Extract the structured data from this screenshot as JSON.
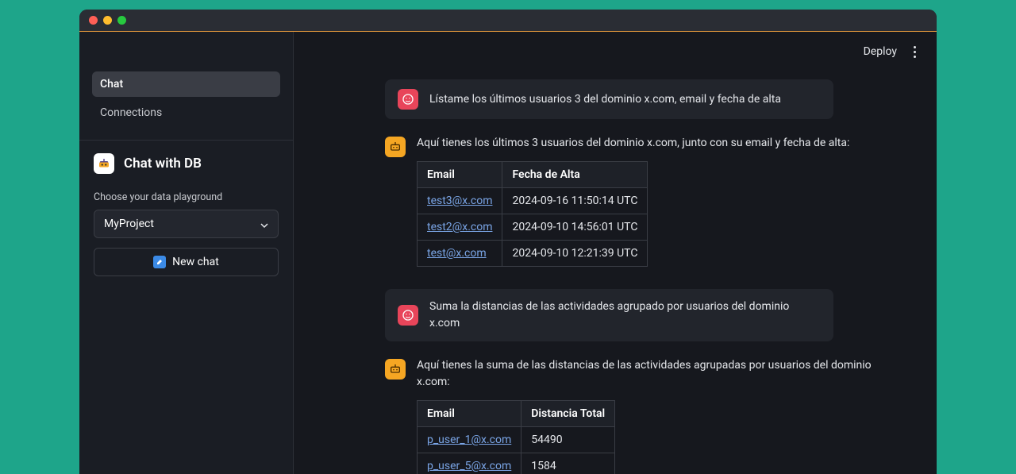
{
  "sidebar": {
    "nav": [
      {
        "label": "Chat",
        "active": true
      },
      {
        "label": "Connections",
        "active": false
      }
    ],
    "appTitle": "Chat with DB",
    "playgroundLabel": "Choose your data playground",
    "project": "MyProject",
    "newChatLabel": "New chat"
  },
  "topbar": {
    "deploy": "Deploy"
  },
  "chat": {
    "msg1": "Lístame los últimos usuarios 3 del dominio x.com, email y fecha de alta",
    "reply1": "Aquí tienes los últimos 3 usuarios del dominio x.com, junto con su email y fecha de alta:",
    "table1": {
      "headers": {
        "email": "Email",
        "date": "Fecha de Alta"
      },
      "rows": [
        {
          "email": "test3@x.com",
          "date": "2024-09-16 11:50:14 UTC"
        },
        {
          "email": "test2@x.com",
          "date": "2024-09-10 14:56:01 UTC"
        },
        {
          "email": "test@x.com",
          "date": "2024-09-10 12:21:39 UTC"
        }
      ]
    },
    "msg2": "Suma la distancias de las actividades agrupado por usuarios del dominio x.com",
    "reply2": "Aquí tienes la suma de las distancias de las actividades agrupadas por usuarios del dominio x.com:",
    "table2": {
      "headers": {
        "email": "Email",
        "dist": "Distancia Total"
      },
      "rows": [
        {
          "email": "p_user_1@x.com",
          "dist": "54490"
        },
        {
          "email": "p_user_5@x.com",
          "dist": "1584"
        }
      ]
    }
  }
}
